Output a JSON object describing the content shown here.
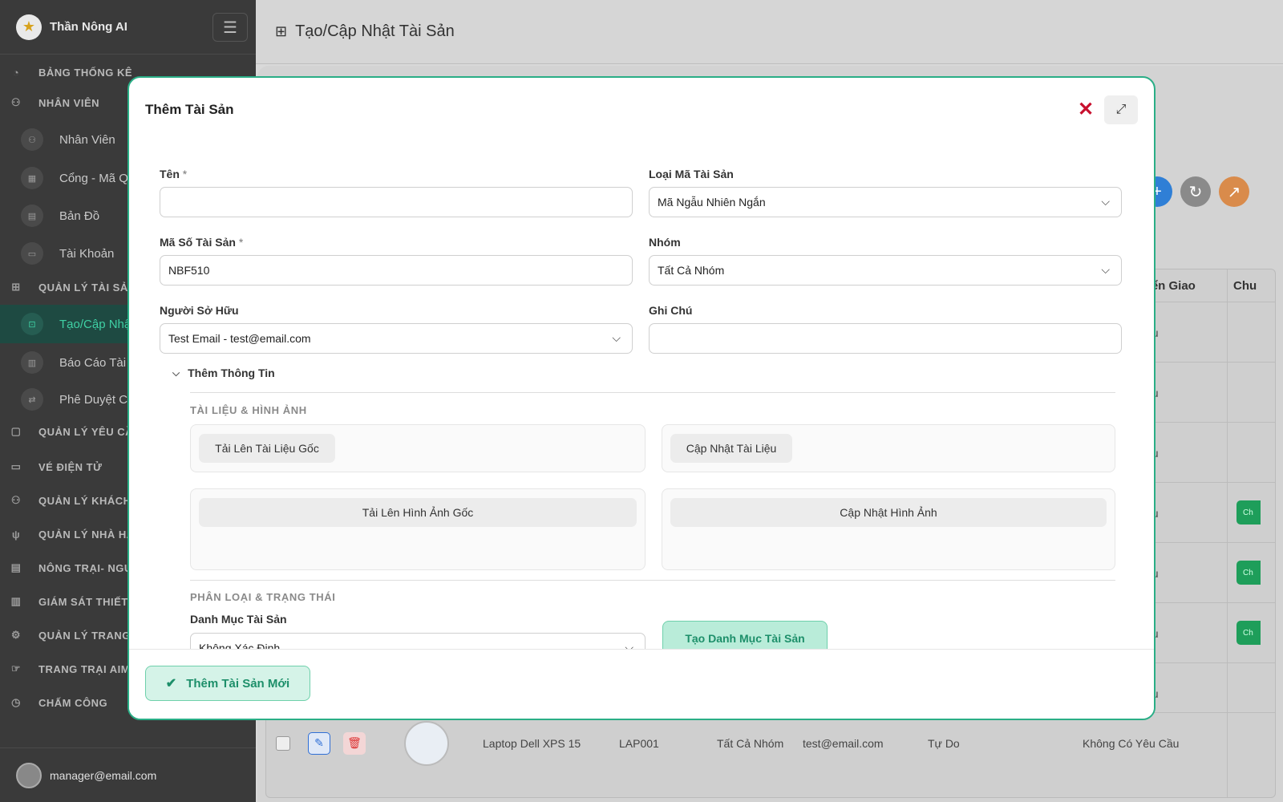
{
  "brand": {
    "name": "Thần Nông AI"
  },
  "nav": {
    "items": [
      {
        "kind": "section",
        "label": "BẢNG THỐNG KÊ",
        "icon": "dashboard-icon",
        "glyph": "◔"
      },
      {
        "kind": "section",
        "label": "NHÂN VIÊN",
        "icon": "users-icon",
        "glyph": "⚇"
      },
      {
        "kind": "sub",
        "label": "Nhân Viên",
        "icon": "users-icon",
        "glyph": "⚇"
      },
      {
        "kind": "sub",
        "label": "Cổng - Mã Q",
        "icon": "qr-icon",
        "glyph": "▦"
      },
      {
        "kind": "sub",
        "label": "Bản Đồ",
        "icon": "map-icon",
        "glyph": "▤"
      },
      {
        "kind": "sub",
        "label": "Tài Khoản",
        "icon": "account-icon",
        "glyph": "▭"
      },
      {
        "kind": "section",
        "label": "QUẢN LÝ TÀI SẢN",
        "icon": "assets-icon",
        "glyph": "⊞"
      },
      {
        "kind": "sub",
        "label": "Tạo/Cập Nhậ",
        "icon": "create-icon",
        "glyph": "⊡",
        "active": true
      },
      {
        "kind": "sub",
        "label": "Báo Cáo Tài",
        "icon": "report-icon",
        "glyph": "▥"
      },
      {
        "kind": "sub",
        "label": "Phê Duyệt C",
        "icon": "transfer-icon",
        "glyph": "⇄"
      },
      {
        "kind": "section",
        "label": "QUẢN LÝ YÊU CẦ",
        "icon": "clipboard-icon",
        "glyph": "▢"
      },
      {
        "kind": "section",
        "label": "VÉ ĐIỆN TỬ",
        "icon": "ticket-icon",
        "glyph": "▭"
      },
      {
        "kind": "section",
        "label": "QUẢN LÝ KHÁCH",
        "icon": "customers-icon",
        "glyph": "⚇"
      },
      {
        "kind": "section",
        "label": "QUẢN LÝ NHÀ HÀ",
        "icon": "restaurant-icon",
        "glyph": "ψ"
      },
      {
        "kind": "section",
        "label": "NÔNG TRẠI- NGU",
        "icon": "farm-icon",
        "glyph": "▤"
      },
      {
        "kind": "section",
        "label": "GIÁM SÁT THIẾT",
        "icon": "monitor-icon",
        "glyph": "▥"
      },
      {
        "kind": "section",
        "label": "QUẢN LÝ TRANG",
        "icon": "bike-icon",
        "glyph": "⚙"
      },
      {
        "kind": "section",
        "label": "TRANG TRẠI AIM",
        "icon": "hand-icon",
        "glyph": "☞"
      },
      {
        "kind": "section",
        "label": "CHẤM CÔNG",
        "icon": "clock-icon",
        "glyph": "◷"
      }
    ]
  },
  "user": {
    "email": "manager@email.com"
  },
  "header": {
    "title": "Tạo/Cập Nhật Tài Sản"
  },
  "table": {
    "headers": [
      "i Chuyển Giao",
      "Chu"
    ],
    "rows": [
      {
        "status": "Yêu Cầu"
      },
      {
        "status": "Yêu Cầu"
      },
      {
        "status": "Yêu Cầu"
      },
      {
        "status": "Yêu Cầu",
        "chip": "Ch"
      },
      {
        "status": "Yêu Cầu",
        "chip": "Ch"
      },
      {
        "status": "Yêu Cầu",
        "chip": "Ch"
      },
      {
        "status": "Yêu Cầu"
      }
    ],
    "last_row": {
      "name": "Laptop Dell XPS 15",
      "code": "LAP001",
      "group": "Tất Cả Nhóm",
      "owner": "test@email.com",
      "state": "Tự Do",
      "transfer": "Không Có Yêu Cầu"
    }
  },
  "modal": {
    "title": "Thêm Tài Sản",
    "name_label": "Tên",
    "name_value": "",
    "asset_code_type_label": "Loại Mã Tài Sản",
    "asset_code_type_value": "Mã Ngẫu Nhiên Ngắn",
    "asset_no_label": "Mã Số Tài Sản",
    "asset_no_value": "NBF510",
    "group_label": "Nhóm",
    "group_value": "Tất Cả Nhóm",
    "owner_label": "Người Sở Hữu",
    "owner_value": "Test Email - test@email.com",
    "note_label": "Ghi Chú",
    "note_value": "",
    "required_mark": "*",
    "more_info": "Thêm Thông Tin",
    "docs_section": "TÀI LIỆU & HÌNH ẢNH",
    "upload_doc": "Tải Lên Tài Liệu Gốc",
    "update_doc": "Cập Nhật Tài Liệu",
    "upload_img": "Tải Lên Hình Ảnh Gốc",
    "update_img": "Cập Nhật Hình Ảnh",
    "class_section": "PHÂN LOẠI & TRẠNG THÁI",
    "category_label": "Danh Mục Tài Sản",
    "category_value": "Không Xác Định",
    "create_category": "Tạo Danh Mục Tài Sản",
    "submit": "Thêm Tài Sản Mới"
  },
  "colors": {
    "accent": "#2aae86",
    "close": "#c8102e",
    "sidebar": "#3a3a3a"
  }
}
